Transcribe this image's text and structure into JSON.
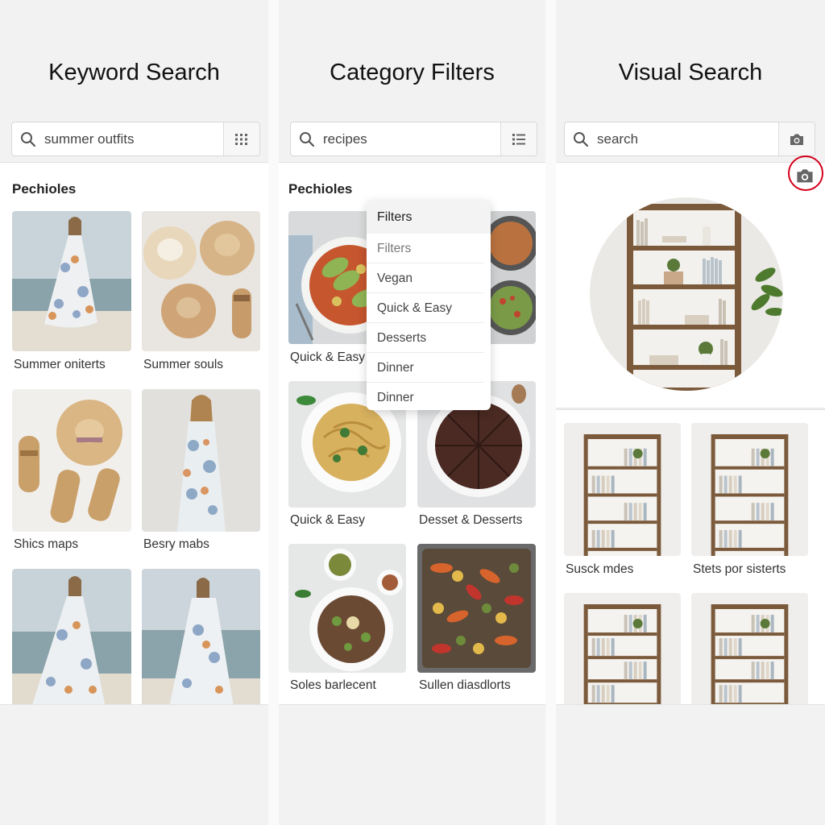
{
  "panels": [
    {
      "title": "Keyword Search",
      "search": {
        "value": "summer outfits",
        "button_icon": "grid-icon"
      },
      "section_label": "Pechioles",
      "captions": [
        "Summer oniterts",
        "Summer souls",
        "Shics maps",
        "Besry mabs"
      ]
    },
    {
      "title": "Category Filters",
      "search": {
        "value": "recipes",
        "button_icon": "list-icon"
      },
      "section_label": "Pechioles",
      "dropdown": {
        "header": "Filters",
        "items": [
          "Filters",
          "Vegan",
          "Quick & Easy",
          "Desserts",
          "Dinner",
          "Dinner"
        ]
      },
      "captions": [
        "Quick & Easy",
        "Quick & Easy",
        "Desset & Desserts",
        "Soles barlecent",
        "Sullen diasdlorts"
      ]
    },
    {
      "title": "Visual Search",
      "search": {
        "value": "search",
        "button_icon": "camera-icon"
      },
      "captions": [
        "Susck mdes",
        "Stets por sisterts"
      ],
      "highlight_icon": "camera-icon",
      "highlight_color": "#d4001a"
    }
  ]
}
